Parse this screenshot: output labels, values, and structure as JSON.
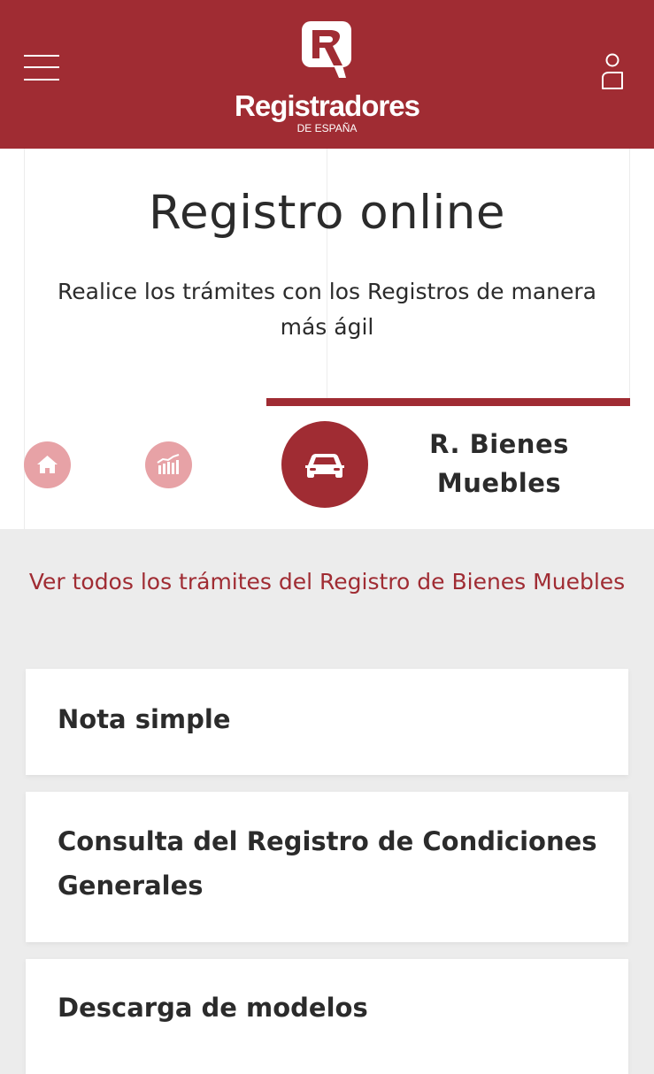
{
  "header": {
    "menu_icon": "hamburger-menu-icon",
    "logo_text": "Registradores",
    "logo_subtext": "DE ESPAÑA",
    "user_icon": "user-icon",
    "background_color": "#a02c33"
  },
  "hero": {
    "title": "Registro online",
    "subtitle": "Realice los trámites con los Registros de manera más ágil"
  },
  "tabs": [
    {
      "name": "home",
      "icon": "home-icon"
    },
    {
      "name": "statistics",
      "icon": "bar-chart-icon"
    },
    {
      "name": "bienes-muebles",
      "icon": "car-icon",
      "label": "R. Bienes Muebles",
      "active": true
    }
  ],
  "section": {
    "see_all_link": "Ver todos los trámites del Registro de Bienes Muebles",
    "cards": [
      {
        "label": "Nota simple"
      },
      {
        "label": "Consulta del Registro de Condiciones Generales"
      },
      {
        "label": "Descarga de modelos"
      }
    ]
  },
  "colors": {
    "accent": "#a02c33",
    "accent_light": "#e7a2a6",
    "background": "#ececec"
  }
}
